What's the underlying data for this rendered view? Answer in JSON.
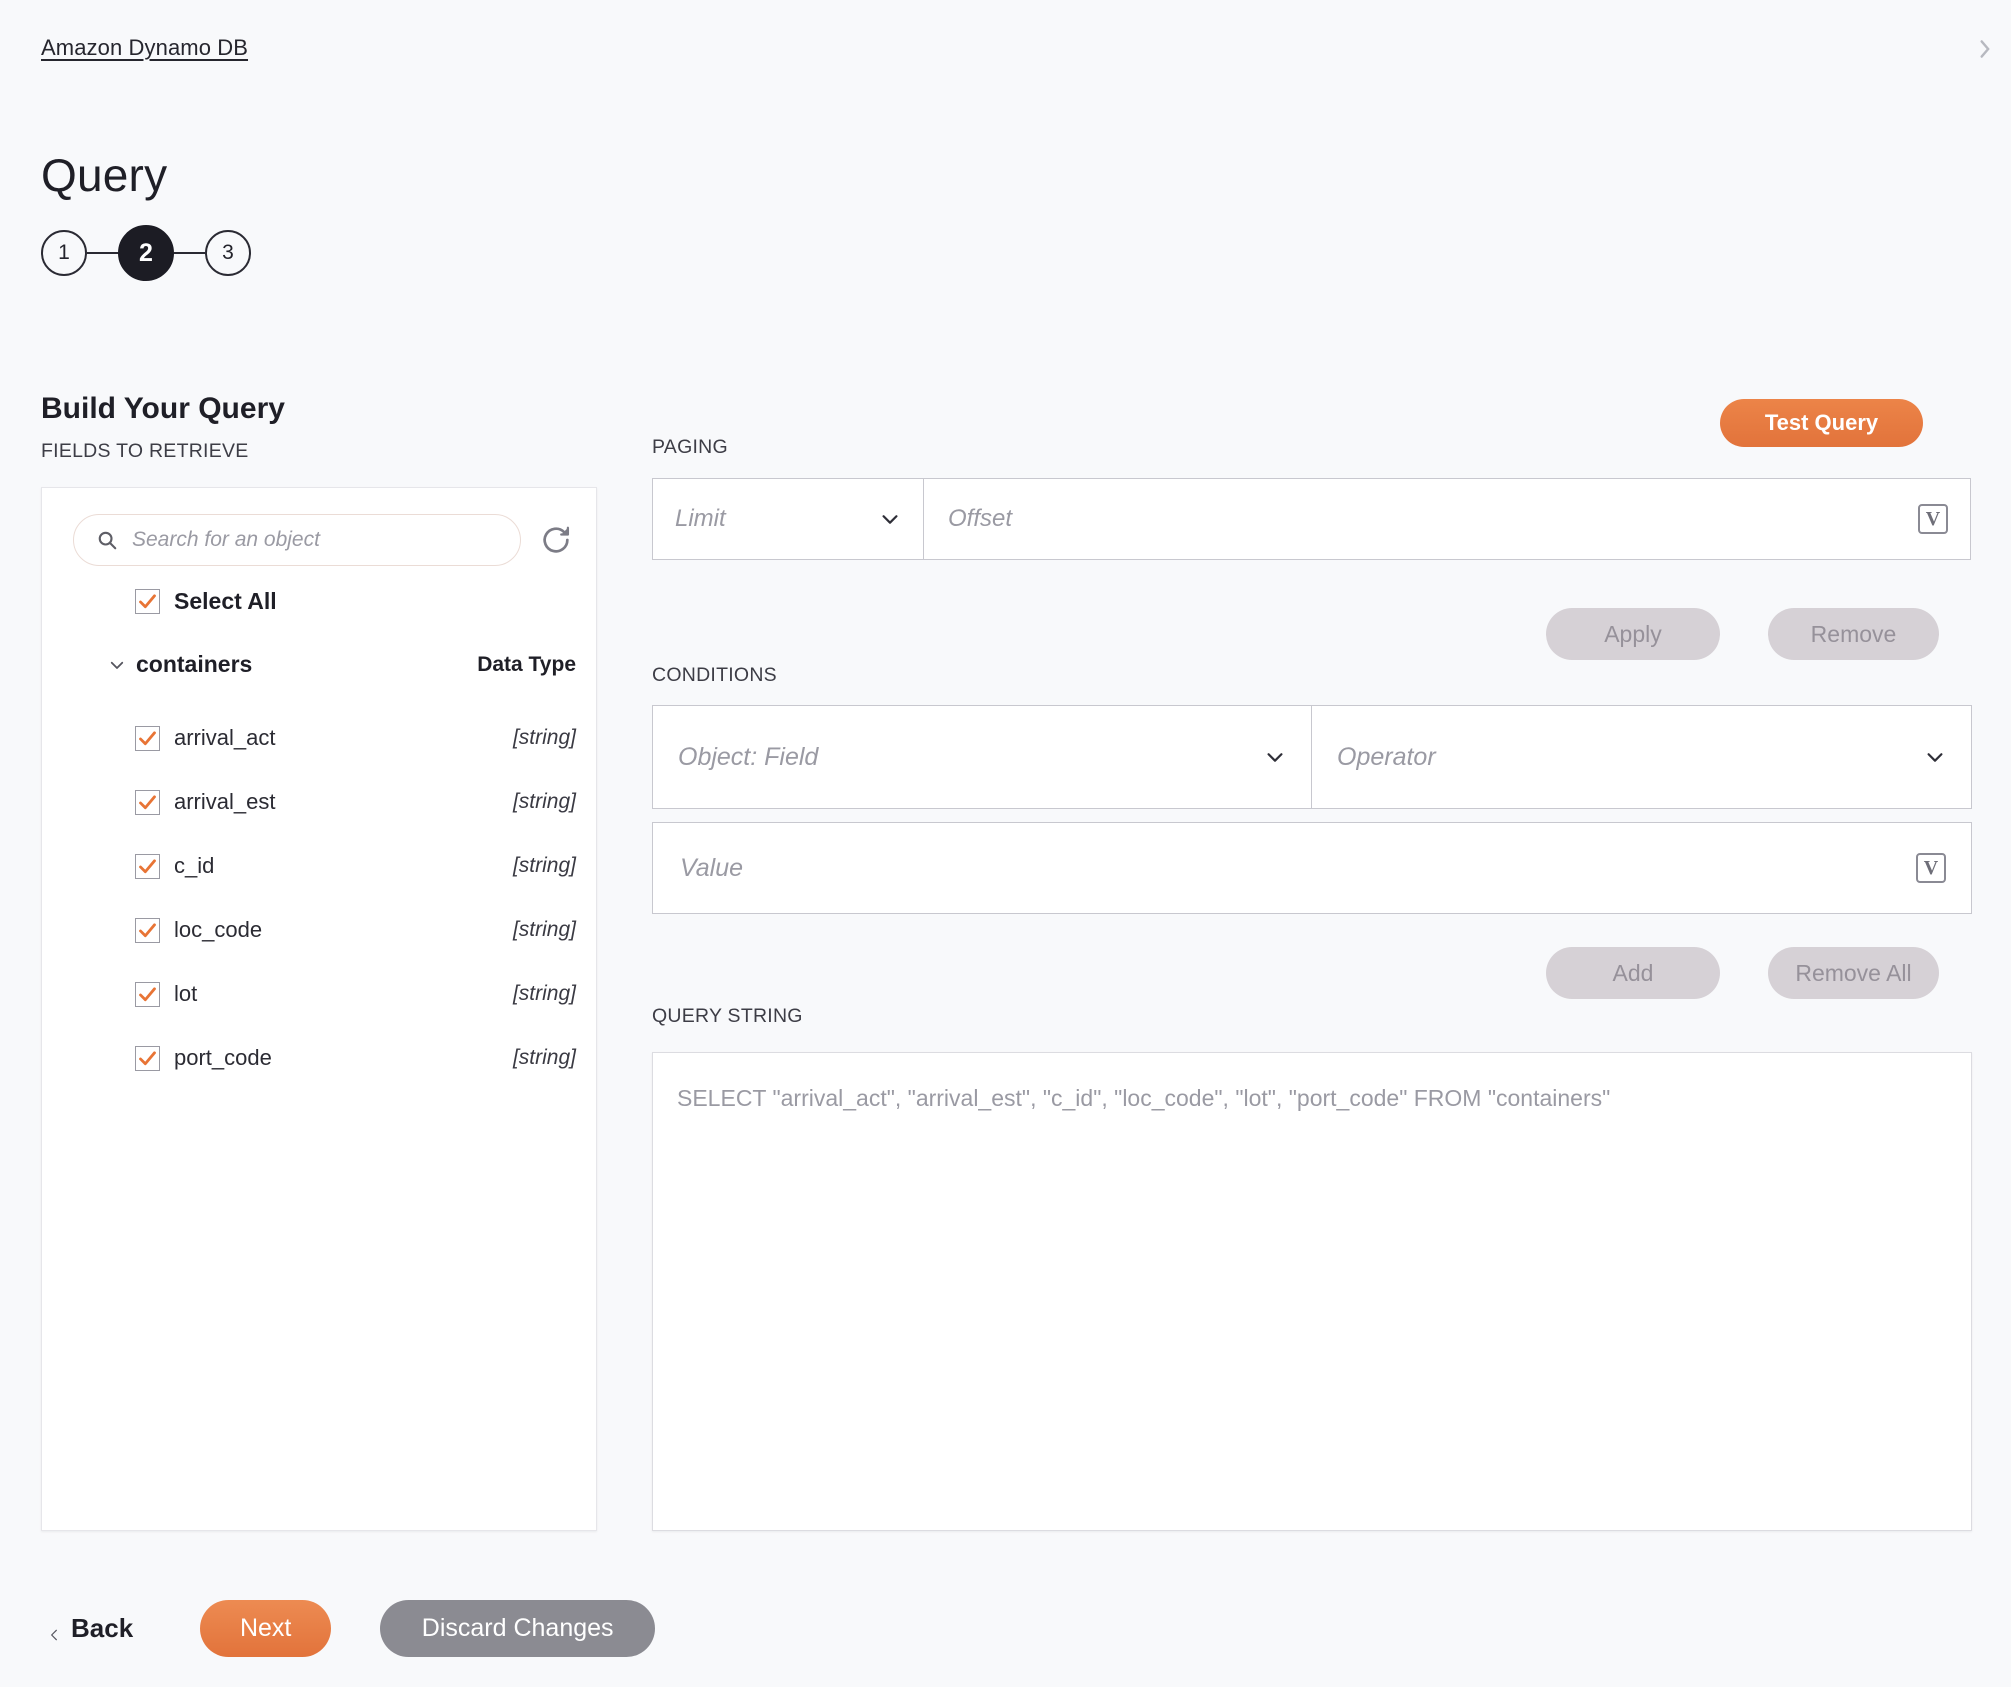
{
  "header": {
    "breadcrumb": "Amazon Dynamo DB",
    "title": "Query",
    "corner_icon": "chevron-right-partial-icon"
  },
  "stepper": {
    "steps": [
      "1",
      "2",
      "3"
    ],
    "active_index": 1
  },
  "section": {
    "title": "Build Your Query",
    "fields_label": "FIELDS TO RETRIEVE"
  },
  "fields_panel": {
    "search": {
      "placeholder": "Search for an object",
      "value": "",
      "icon": "search-icon"
    },
    "refresh_icon": "refresh-icon",
    "select_all": {
      "label": "Select All",
      "checked": true
    },
    "object": {
      "name": "containers",
      "expanded": true,
      "data_type_header": "Data Type"
    },
    "fields": [
      {
        "name": "arrival_act",
        "type": "[string]",
        "checked": true
      },
      {
        "name": "arrival_est",
        "type": "[string]",
        "checked": true
      },
      {
        "name": "c_id",
        "type": "[string]",
        "checked": true
      },
      {
        "name": "loc_code",
        "type": "[string]",
        "checked": true
      },
      {
        "name": "lot",
        "type": "[string]",
        "checked": true
      },
      {
        "name": "port_code",
        "type": "[string]",
        "checked": true
      }
    ]
  },
  "right_panel": {
    "test_query_label": "Test Query",
    "paging": {
      "label": "PAGING",
      "limit_placeholder": "Limit",
      "limit_value": "",
      "offset_placeholder": "Offset",
      "offset_value": "",
      "variable_icon_label": "V",
      "apply_label": "Apply",
      "remove_label": "Remove"
    },
    "conditions": {
      "label": "CONDITIONS",
      "object_field_placeholder": "Object: Field",
      "object_field_value": "",
      "operator_placeholder": "Operator",
      "operator_value": "",
      "value_placeholder": "Value",
      "value_value": "",
      "variable_icon_label": "V",
      "add_label": "Add",
      "remove_all_label": "Remove All"
    },
    "query_string": {
      "label": "QUERY STRING",
      "text": "SELECT \"arrival_act\", \"arrival_est\", \"c_id\", \"loc_code\", \"lot\", \"port_code\" FROM \"containers\""
    }
  },
  "footer": {
    "back_label": "Back",
    "next_label": "Next",
    "discard_label": "Discard Changes"
  },
  "colors": {
    "accent": "#e2733b",
    "accent_light": "#ec8448",
    "page_bg": "#f8f9fb",
    "panel_bg": "#ffffff",
    "muted": "#9a9aa3",
    "disabled_btn": "#d6d1d6",
    "discard_gray": "#8b8b92",
    "dark": "#1c1c24"
  }
}
